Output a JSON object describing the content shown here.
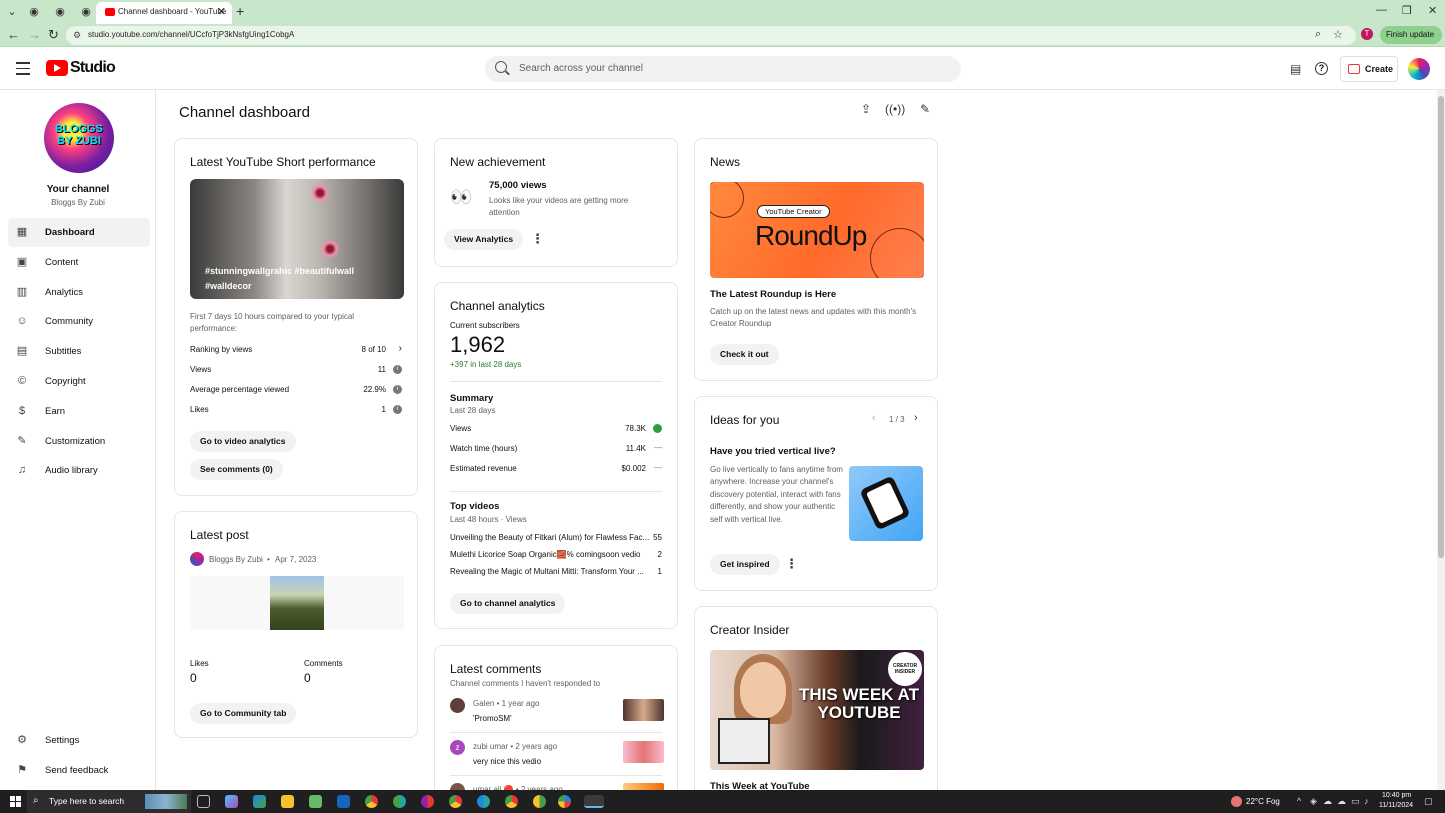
{
  "browser": {
    "tab_title": "Channel dashboard - YouTube",
    "url": "studio.youtube.com/channel/UCcfoTjP3kNsfgUing1CobgA",
    "profile_initial": "T",
    "finish_update": "Finish update"
  },
  "header": {
    "logo_text": "Studio",
    "search_placeholder": "Search across your channel",
    "create_label": "Create"
  },
  "sidebar": {
    "avatar_text": "BLOGGS BY ZUBI",
    "your_channel": "Your channel",
    "channel_name": "Bloggs By Zubi",
    "items": [
      {
        "label": "Dashboard",
        "icon": "dashboard-icon"
      },
      {
        "label": "Content",
        "icon": "content-icon"
      },
      {
        "label": "Analytics",
        "icon": "analytics-icon"
      },
      {
        "label": "Community",
        "icon": "community-icon"
      },
      {
        "label": "Subtitles",
        "icon": "subtitles-icon"
      },
      {
        "label": "Copyright",
        "icon": "copyright-icon"
      },
      {
        "label": "Earn",
        "icon": "earn-icon"
      },
      {
        "label": "Customization",
        "icon": "customization-icon"
      },
      {
        "label": "Audio library",
        "icon": "audio-library-icon"
      }
    ],
    "bottom": [
      {
        "label": "Settings",
        "icon": "settings-icon"
      },
      {
        "label": "Send feedback",
        "icon": "feedback-icon"
      }
    ]
  },
  "page_title": "Channel dashboard",
  "short_card": {
    "title": "Latest YouTube Short performance",
    "caption": "#stunningwallgrahic #beautifulwall #walldecor",
    "note": "First 7 days 10 hours compared to your typical performance:",
    "stats": [
      {
        "label": "Ranking by views",
        "value": "8 of 10"
      },
      {
        "label": "Views",
        "value": "11"
      },
      {
        "label": "Average percentage viewed",
        "value": "22.9%"
      },
      {
        "label": "Likes",
        "value": "1"
      }
    ],
    "btn_analytics": "Go to video analytics",
    "btn_comments": "See comments (0)"
  },
  "post_card": {
    "title": "Latest post",
    "author": "Bloggs By Zubi",
    "date": "Apr 7, 2023",
    "likes_label": "Likes",
    "likes_value": "0",
    "comments_label": "Comments",
    "comments_value": "0",
    "btn": "Go to Community tab"
  },
  "achievement_card": {
    "title": "New achievement",
    "headline": "75,000 views",
    "desc": "Looks like your videos are getting more attention",
    "btn": "View Analytics"
  },
  "analytics_card": {
    "title": "Channel analytics",
    "subs_label": "Current subscribers",
    "subs_value": "1,962",
    "subs_change": "+397 in last 28 days",
    "summary_title": "Summary",
    "summary_sub": "Last 28 days",
    "summary": [
      {
        "label": "Views",
        "value": "78.3K"
      },
      {
        "label": "Watch time (hours)",
        "value": "11.4K"
      },
      {
        "label": "Estimated revenue",
        "value": "$0.002"
      }
    ],
    "top_title": "Top videos",
    "top_sub": "Last 48 hours · Views",
    "top_videos": [
      {
        "title": "Unveiling the Beauty of Fitkari (Alum) for Flawless Fac...",
        "views": "55"
      },
      {
        "title": "Mulethi Licorice Soap Organic🧱% comingsoon vedio",
        "views": "2"
      },
      {
        "title": "Revealing the Magic of Multani Mitti: Transform Your ...",
        "views": "1"
      }
    ],
    "btn": "Go to channel analytics"
  },
  "comments_card": {
    "title": "Latest comments",
    "sub": "Channel comments I haven't responded to",
    "comments": [
      {
        "author": "Galen • 1 year ago",
        "text": "'PromoSM'"
      },
      {
        "author": "zubi umar • 2 years ago",
        "text": "very nice this vedio",
        "initial": "z"
      },
      {
        "author": "umar ali 🔴 • 2 years ago",
        "text": ""
      }
    ]
  },
  "news_card": {
    "title": "News",
    "img_tag": "YouTube Creator",
    "img_big": "RoundUp",
    "headline": "The Latest Roundup is Here",
    "desc": "Catch up on the latest news and updates with this month's Creator Roundup",
    "btn": "Check it out"
  },
  "ideas_card": {
    "title": "Ideas for you",
    "pager": "1 / 3",
    "headline": "Have you tried vertical live?",
    "desc": "Go live vertically to fans anytime from anywhere. Increase your channel's discovery potential, interact with fans differently, and show your authentic self with vertical live.",
    "btn": "Get inspired"
  },
  "insider_card": {
    "title": "Creator Insider",
    "img_text": "THIS WEEK AT YOUTUBE",
    "badge": "CREATOR INSIDER",
    "caption": "This Week at YouTube"
  },
  "taskbar": {
    "search_placeholder": "Type here to search",
    "weather": "22°C Fog",
    "time": "10:40 pm",
    "date": "11/11/2024"
  }
}
